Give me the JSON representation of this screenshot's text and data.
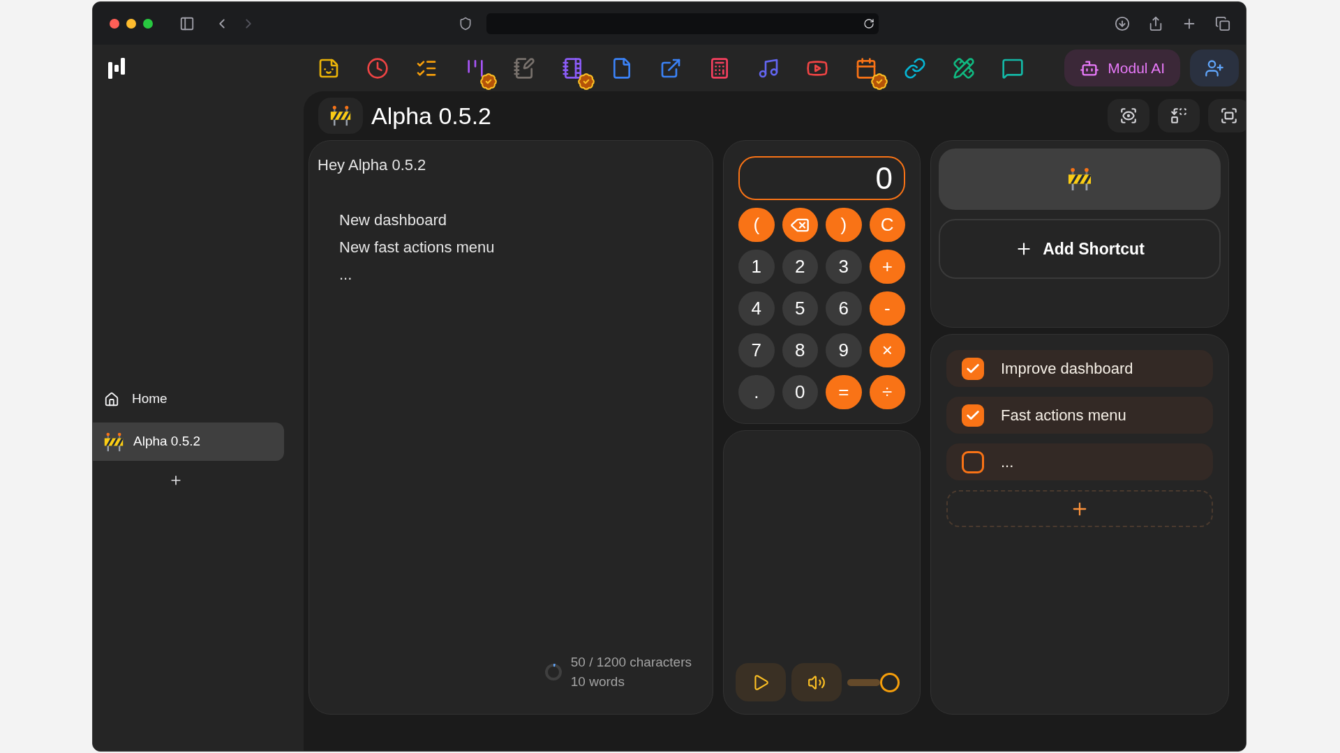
{
  "sidebar": {
    "items": [
      {
        "kind": "home",
        "label": "Home",
        "selected": false
      },
      {
        "kind": "project",
        "label": "Alpha 0.5.2",
        "selected": true
      }
    ]
  },
  "toolbar": {
    "apps": [
      {
        "kind": "sticker",
        "verified": false
      },
      {
        "kind": "clock",
        "verified": false
      },
      {
        "kind": "checklist",
        "verified": false
      },
      {
        "kind": "bars",
        "verified": true
      },
      {
        "kind": "notebook-pen",
        "verified": false
      },
      {
        "kind": "notebook",
        "verified": true
      },
      {
        "kind": "file",
        "verified": false
      },
      {
        "kind": "external-link",
        "verified": false
      },
      {
        "kind": "calculator",
        "verified": false
      },
      {
        "kind": "music",
        "verified": false
      },
      {
        "kind": "video",
        "verified": false
      },
      {
        "kind": "calendar",
        "verified": true
      },
      {
        "kind": "link",
        "verified": false
      },
      {
        "kind": "pencil-ruler",
        "verified": false
      },
      {
        "kind": "message",
        "verified": false
      }
    ],
    "ai_button": "Modul AI"
  },
  "page": {
    "title": "Alpha 0.5.2"
  },
  "note": {
    "greeting": "Hey Alpha 0.5.2",
    "lines": [
      "New dashboard",
      "New fast actions menu",
      "..."
    ],
    "counter": {
      "level": 0.04,
      "characters": "50 / 1200 characters",
      "words": "10 words"
    }
  },
  "calculator": {
    "display": "0",
    "keys": [
      {
        "kind": "operator",
        "label": "("
      },
      {
        "kind": "backspace"
      },
      {
        "kind": "operator",
        "label": ")"
      },
      {
        "kind": "operator",
        "label": "C"
      },
      {
        "kind": "digit",
        "label": "1"
      },
      {
        "kind": "digit",
        "label": "2"
      },
      {
        "kind": "digit",
        "label": "3"
      },
      {
        "kind": "operator",
        "label": "+"
      },
      {
        "kind": "digit",
        "label": "4"
      },
      {
        "kind": "digit",
        "label": "5"
      },
      {
        "kind": "digit",
        "label": "6"
      },
      {
        "kind": "operator",
        "label": "-"
      },
      {
        "kind": "digit",
        "label": "7"
      },
      {
        "kind": "digit",
        "label": "8"
      },
      {
        "kind": "digit",
        "label": "9"
      },
      {
        "kind": "operator",
        "label": "×"
      },
      {
        "kind": "digit",
        "label": "."
      },
      {
        "kind": "digit",
        "label": "0"
      },
      {
        "kind": "operator",
        "label": "="
      },
      {
        "kind": "operator",
        "label": "÷"
      }
    ]
  },
  "player": {
    "volume": {
      "level": 1
    }
  },
  "shortcuts": {
    "add_label": "Add Shortcut"
  },
  "todos": [
    {
      "label": "Improve dashboard",
      "checked": true
    },
    {
      "label": "Fast actions menu",
      "checked": true
    },
    {
      "label": "...",
      "checked": false
    }
  ]
}
